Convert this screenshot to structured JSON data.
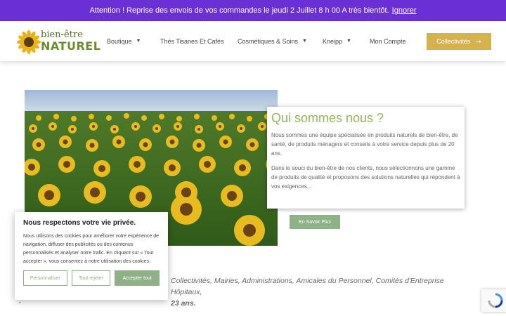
{
  "announcement": {
    "text": "Attention ! Reprise des envois de vos commandes le jeudi 2 Juillet 8 h 00 A très bientôt.",
    "dismiss_label": "Ignorer"
  },
  "logo": {
    "line1": "bien-être",
    "line2": "NATUREL"
  },
  "nav": {
    "items": [
      {
        "label": "Boutique",
        "has_caret": true
      },
      {
        "label": "Thés Tisanes Et Cafés",
        "has_caret": false
      },
      {
        "label": "Cosmétiques & Soins",
        "has_caret": true
      },
      {
        "label": "Kneipp",
        "has_caret": true
      },
      {
        "label": "Mon Compte",
        "has_caret": false
      }
    ],
    "cta_label": "Collectivités",
    "cta_icon": "arrow-right-icon"
  },
  "about": {
    "title": "Qui sommes nous ?",
    "paragraph1": "Nous sommes une équipe spécialisée en produits naturels de bien-être, de santé, de produits ménagers et conseils à votre service depuis plus de 20 ans.",
    "paragraph2": "Dans le souci du bien-être de nos clients, nous sélectionnons une gamme de produits de qualité et proposons des solutions naturelles qui répondent à vos exigences...",
    "button_label": "En Savoir Plus"
  },
  "body": {
    "line1": "Collectivités, Mairies, Administrations, Amicales du Personnel, Comités d'Entreprise Hôpitaux,",
    "line2_bold": "23 ans."
  },
  "cookie": {
    "title": "Nous respectons votre vie privée.",
    "text": "Nous utilisons des cookies pour améliorer votre expérience de navigation, diffuser des publicités ou des contenus personnalisés et analyser notre trafic. En cliquant sur « Tout accepter », vous consentez à notre utilisation des cookies.",
    "customize_label": "Personnaliser",
    "reject_label": "Tout rejeter",
    "accept_label": "Accepter tout"
  },
  "footer_mark": "*",
  "colors": {
    "announcement_bg": "#6b2fd6",
    "accent_green": "#8fb187",
    "title_green": "#93b55e",
    "cta_gold": "#d4b24c"
  }
}
